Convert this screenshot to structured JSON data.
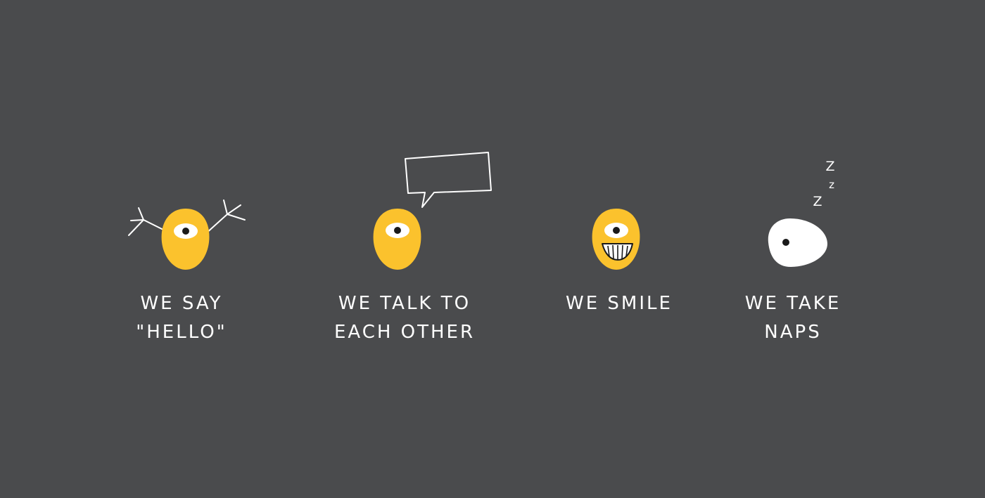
{
  "colors": {
    "background": "#4a4b4d",
    "creature_yellow": "#fbc22d",
    "creature_white": "#ffffff",
    "text": "#ffffff",
    "pupil": "#1a1a1a"
  },
  "creatures": [
    {
      "id": "hello",
      "icon": "waving-creature-icon",
      "caption_lines": [
        "WE SAY",
        "\"HELLO\""
      ]
    },
    {
      "id": "talk",
      "icon": "talking-creature-icon",
      "caption_lines": [
        "WE TALK TO",
        "EACH OTHER"
      ]
    },
    {
      "id": "smile",
      "icon": "smiling-creature-icon",
      "caption_lines": [
        "WE SMILE"
      ]
    },
    {
      "id": "naps",
      "icon": "sleeping-creature-icon",
      "caption_lines": [
        "WE TAKE",
        "NAPS"
      ],
      "sleep_letters": [
        "Z",
        "z",
        "Z"
      ]
    }
  ]
}
